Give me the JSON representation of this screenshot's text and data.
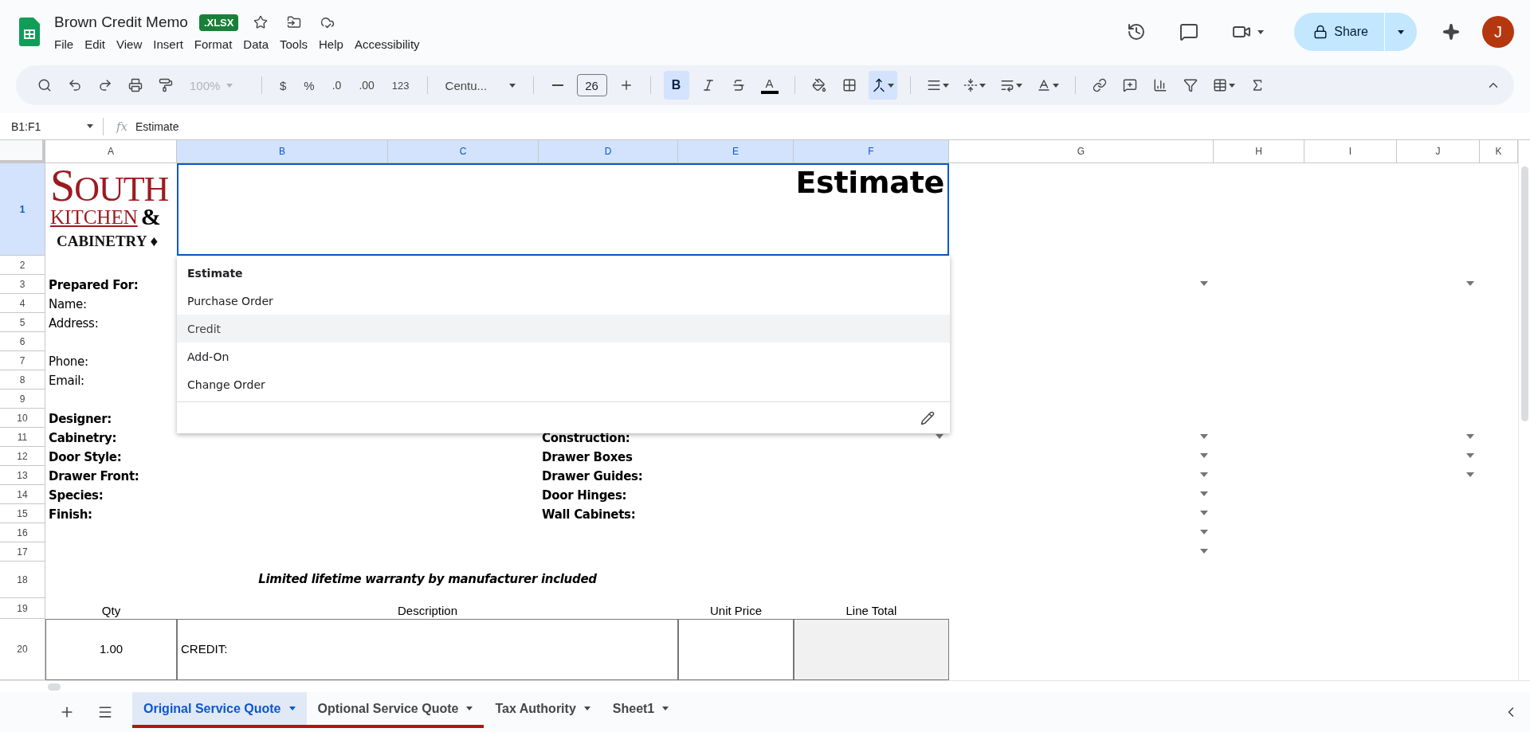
{
  "title_bar": {
    "document_title": "Brown Credit Memo",
    "file_badge": ".XLSX",
    "menu": [
      "File",
      "Edit",
      "View",
      "Insert",
      "Format",
      "Data",
      "Tools",
      "Help",
      "Accessibility"
    ],
    "share_label": "Share",
    "avatar_letter": "J"
  },
  "toolbar": {
    "zoom": "100%",
    "zoom_disabled": true,
    "currency": "$",
    "percent": "%",
    "decrease_decimals": ".0",
    "increase_decimals": ".00",
    "number_format": "123",
    "font": "Centu...",
    "font_size": "26",
    "bold": {
      "label": "B",
      "on": true
    },
    "text_color_label": "A",
    "merge_on": true
  },
  "formula_bar": {
    "name_box": "B1:F1",
    "fx": "fx",
    "content": "Estimate"
  },
  "columns": [
    {
      "label": "A",
      "selected": false
    },
    {
      "label": "B",
      "selected": true
    },
    {
      "label": "C",
      "selected": true
    },
    {
      "label": "D",
      "selected": true
    },
    {
      "label": "E",
      "selected": true
    },
    {
      "label": "F",
      "selected": true
    },
    {
      "label": "G",
      "selected": false
    },
    {
      "label": "H",
      "selected": false
    },
    {
      "label": "I",
      "selected": false
    },
    {
      "label": "J",
      "selected": false
    },
    {
      "label": "K",
      "selected": false
    }
  ],
  "rows": [
    {
      "number": "1",
      "selected": true,
      "cells": {
        "A": {
          "kind": "logo",
          "line1": "SOUTH",
          "line2": "KITCHEN",
          "amp": "&",
          "line3": "CABINETRY ♦"
        },
        "B-F": {
          "kind": "title",
          "text": "Estimate",
          "selected": true
        }
      }
    },
    {
      "number": "2",
      "selected": false,
      "cells": {}
    },
    {
      "number": "3",
      "selected": false,
      "cells": {
        "A": {
          "kind": "label",
          "text": "Prepared For:",
          "bold": true
        },
        "G": {
          "kind": "chip",
          "chip_arrow": true
        },
        "J": {
          "kind": "chip",
          "chip_arrow": true
        }
      }
    },
    {
      "number": "4",
      "selected": false,
      "cells": {
        "A": {
          "kind": "label",
          "text": "Name:",
          "bold": false
        }
      }
    },
    {
      "number": "5",
      "selected": false,
      "cells": {
        "A": {
          "kind": "label",
          "text": "Address:",
          "bold": false
        }
      }
    },
    {
      "number": "6",
      "selected": false,
      "cells": {}
    },
    {
      "number": "7",
      "selected": false,
      "cells": {
        "A": {
          "kind": "label",
          "text": "Phone:",
          "bold": false
        }
      }
    },
    {
      "number": "8",
      "selected": false,
      "cells": {
        "A": {
          "kind": "label",
          "text": "Email:",
          "bold": false
        }
      }
    },
    {
      "number": "9",
      "selected": false,
      "cells": {}
    },
    {
      "number": "10",
      "selected": false,
      "cells": {
        "A": {
          "kind": "label",
          "text": "Designer:",
          "bold": true
        }
      }
    },
    {
      "number": "11",
      "selected": false,
      "cells": {
        "A": {
          "kind": "label",
          "text": "Cabinetry:",
          "bold": true
        },
        "D": {
          "kind": "label",
          "text": "Construction:",
          "bold": true
        },
        "F": {
          "kind": "chip",
          "chip_arrow": true
        },
        "G": {
          "kind": "chip",
          "chip_arrow": true
        },
        "J": {
          "kind": "chip",
          "chip_arrow": true
        }
      }
    },
    {
      "number": "12",
      "selected": false,
      "cells": {
        "A": {
          "kind": "label",
          "text": "Door Style:",
          "bold": true
        },
        "D": {
          "kind": "label",
          "text": "Drawer Boxes",
          "bold": true
        },
        "G": {
          "kind": "chip",
          "chip_arrow": true
        },
        "J": {
          "kind": "chip",
          "chip_arrow": true
        }
      }
    },
    {
      "number": "13",
      "selected": false,
      "cells": {
        "A": {
          "kind": "label",
          "text": "Drawer Front:",
          "bold": true
        },
        "D": {
          "kind": "label",
          "text": "Drawer Guides:",
          "bold": true
        },
        "G": {
          "kind": "chip",
          "chip_arrow": true
        },
        "J": {
          "kind": "chip",
          "chip_arrow": true
        }
      }
    },
    {
      "number": "14",
      "selected": false,
      "cells": {
        "A": {
          "kind": "label",
          "text": "Species:",
          "bold": true
        },
        "D": {
          "kind": "label",
          "text": "Door Hinges:",
          "bold": true
        },
        "G": {
          "kind": "chip",
          "chip_arrow": true
        }
      }
    },
    {
      "number": "15",
      "selected": false,
      "cells": {
        "A": {
          "kind": "label",
          "text": "Finish:",
          "bold": true
        },
        "D": {
          "kind": "label",
          "text": "Wall Cabinets:",
          "bold": true
        },
        "G": {
          "kind": "chip",
          "chip_arrow": true
        }
      }
    },
    {
      "number": "16",
      "selected": false,
      "cells": {
        "G": {
          "kind": "chip",
          "chip_arrow": true
        }
      }
    },
    {
      "number": "17",
      "selected": false,
      "cells": {
        "G": {
          "kind": "chip",
          "chip_arrow": true
        }
      }
    },
    {
      "number": "18",
      "selected": false,
      "cells": {
        "B-D": {
          "kind": "note",
          "text": "Limited lifetime warranty by manufacturer included"
        }
      }
    },
    {
      "number": "19",
      "selected": false,
      "cells": {
        "A": {
          "kind": "heading",
          "text": "Qty"
        },
        "B-D": {
          "kind": "heading",
          "text": "Description"
        },
        "E": {
          "kind": "heading",
          "text": "Unit Price"
        },
        "F": {
          "kind": "heading",
          "text": "Line Total"
        }
      }
    },
    {
      "number": "20",
      "selected": false,
      "cells": {
        "A": {
          "kind": "number",
          "text": "1.00",
          "bordered": true
        },
        "B-D": {
          "kind": "plain",
          "text": "CREDIT:",
          "bordered": true
        },
        "E": {
          "kind": "plain",
          "bordered": true
        },
        "F": {
          "kind": "plain",
          "bordered": true,
          "shaded": true
        }
      }
    }
  ],
  "dropdown": {
    "options": [
      {
        "label": "Estimate",
        "selected": true,
        "hovered": false
      },
      {
        "label": "Purchase Order",
        "selected": false,
        "hovered": false
      },
      {
        "label": "Credit",
        "selected": false,
        "hovered": true
      },
      {
        "label": "Add-On",
        "selected": false,
        "hovered": false
      },
      {
        "label": "Change Order",
        "selected": false,
        "hovered": false
      }
    ]
  },
  "sheet_tabs": [
    {
      "label": "Original Service Quote",
      "selected": true,
      "color": "#b31412"
    },
    {
      "label": "Optional Service Quote",
      "selected": false,
      "color": "#b31412"
    },
    {
      "label": "Tax Authority",
      "selected": false
    },
    {
      "label": "Sheet1",
      "selected": false
    }
  ]
}
